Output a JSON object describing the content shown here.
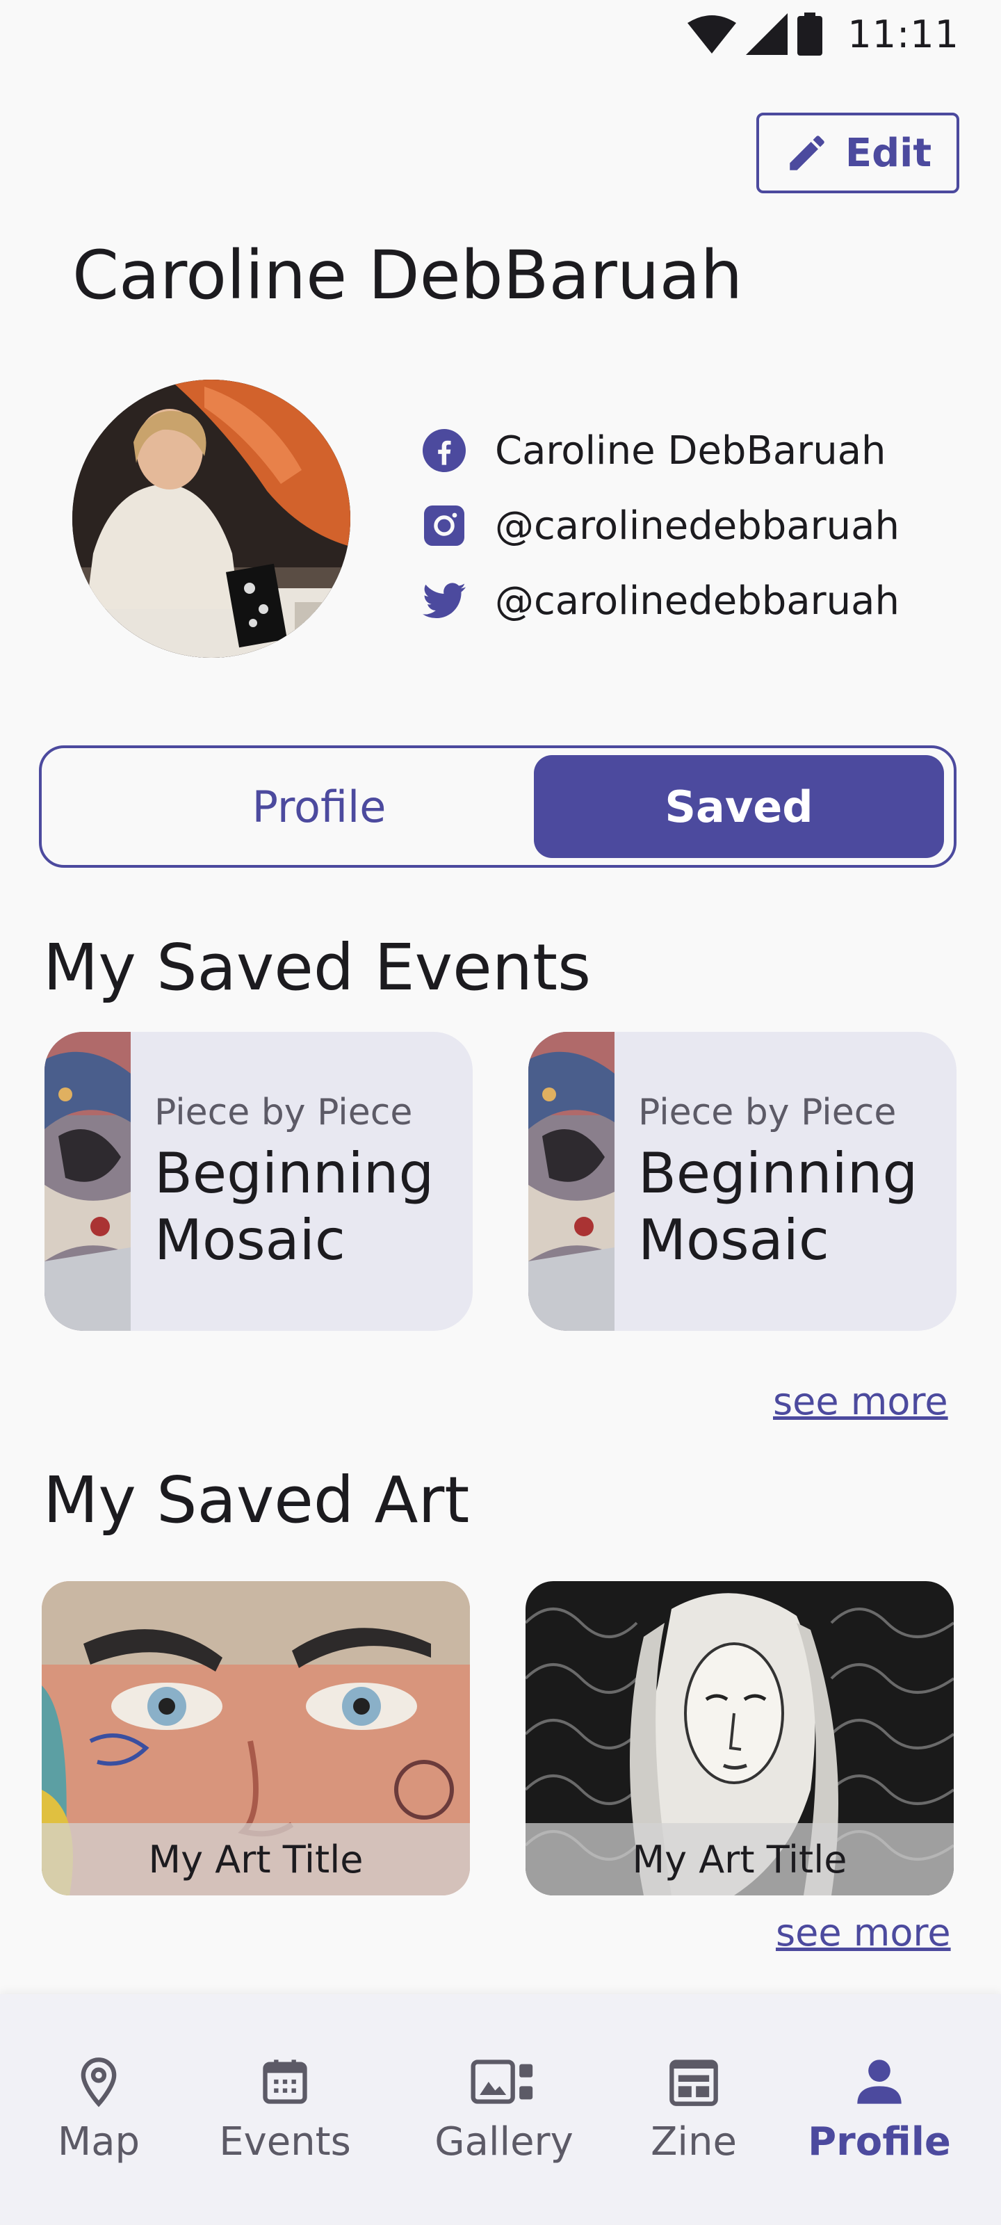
{
  "status_bar": {
    "time": "11:11",
    "icons": [
      "wifi-icon",
      "signal-icon",
      "battery-icon"
    ]
  },
  "header": {
    "edit_label": "Edit",
    "edit_icon": "pencil-icon",
    "name": "Caroline DebBaruah"
  },
  "socials": [
    {
      "icon": "facebook-icon",
      "text": "Caroline DebBaruah"
    },
    {
      "icon": "instagram-icon",
      "text": "@carolinedebbaruah"
    },
    {
      "icon": "twitter-icon",
      "text": "@carolinedebbaruah"
    }
  ],
  "toggle": {
    "profile_label": "Profile",
    "saved_label": "Saved",
    "selected": "Saved"
  },
  "saved_events": {
    "title": "My Saved Events",
    "items": [
      {
        "subtitle": "Piece by Piece",
        "title": "Beginning Mosaic"
      },
      {
        "subtitle": "Piece by Piece",
        "title": "Beginning Mosaic"
      }
    ],
    "see_more": "see more"
  },
  "saved_art": {
    "title": "My Saved Art",
    "items": [
      {
        "caption": "My Art Title"
      },
      {
        "caption": "My Art Title"
      }
    ],
    "see_more": "see more"
  },
  "nav": {
    "items": [
      {
        "label": "Map",
        "icon": "map-pin-icon"
      },
      {
        "label": "Events",
        "icon": "calendar-icon"
      },
      {
        "label": "Gallery",
        "icon": "gallery-icon"
      },
      {
        "label": "Zine",
        "icon": "zine-icon"
      },
      {
        "label": "Profile",
        "icon": "person-icon"
      }
    ],
    "active": "Profile"
  },
  "colors": {
    "accent": "#4c4a9e",
    "card_bg": "#e8e8f1",
    "background": "#f9f9f9"
  }
}
